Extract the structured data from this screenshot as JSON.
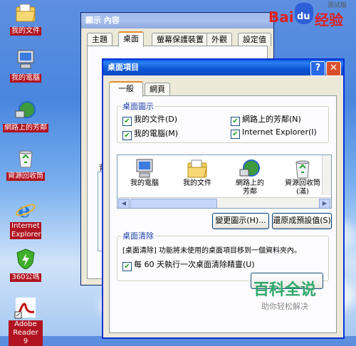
{
  "desktop_icons": [
    {
      "label": "我的文件",
      "icon": "my-documents-icon"
    },
    {
      "label": "我的電腦",
      "icon": "my-computer-icon"
    },
    {
      "label": "網路上的芳鄰",
      "icon": "network-places-icon"
    },
    {
      "label": "資源回收筒",
      "icon": "recycle-bin-icon"
    },
    {
      "label": "Internet Explorer",
      "icon": "internet-explorer-icon"
    },
    {
      "label": "360公瑪",
      "icon": "360-security-icon"
    },
    {
      "label": "Adobe Reader 9",
      "icon": "adobe-reader-icon"
    }
  ],
  "display_window": {
    "title": "顯示 內容",
    "tabs": [
      "主題",
      "桌面",
      "螢幕保護裝置",
      "外觀",
      "設定值"
    ],
    "active_tab": "桌面",
    "partial_label": "背"
  },
  "dialog": {
    "title": "桌面項目",
    "tabs": [
      "一般",
      "網頁"
    ],
    "active_tab": "一般",
    "group_icons_title": "桌面圖示",
    "checkboxes": [
      {
        "label": "我的文件(D)",
        "checked": true
      },
      {
        "label": "網路上的芳鄰(N)",
        "checked": true
      },
      {
        "label": "我的電腦(M)",
        "checked": true
      },
      {
        "label": "Internet Explorer(I)",
        "checked": true
      }
    ],
    "icon_list": [
      {
        "label": "我的電腦",
        "icon": "my-computer-icon"
      },
      {
        "label": "我的文件",
        "icon": "my-documents-icon"
      },
      {
        "label": "網路上的芳鄰",
        "icon": "network-places-icon"
      },
      {
        "label": "資源回收筒(滿)",
        "icon": "recycle-bin-full-icon"
      }
    ],
    "change_icon_button": "變更圖示(H)...",
    "restore_default_button": "還原成預設值(S)",
    "cleanup_title": "桌面清除",
    "cleanup_text": "[桌面清除] 功能將未使用的桌面項目移到一個資料夾內。",
    "cleanup_checkbox": {
      "label": "每 60 天執行一次桌面清除精靈(U)",
      "checked": true
    }
  },
  "watermarks": {
    "baidu_text": "Bai",
    "baidu_du": "du",
    "baidu_jingyan": "经验",
    "baidu_test": "测试版",
    "baike_title": "百科全说",
    "baike_subtitle": "助你轻松解决"
  },
  "colors": {
    "title_active": "#0a55d4",
    "close_button": "#d9512c",
    "desktop_label_bg": "#b11320",
    "group_title": "#1c3fa5"
  }
}
